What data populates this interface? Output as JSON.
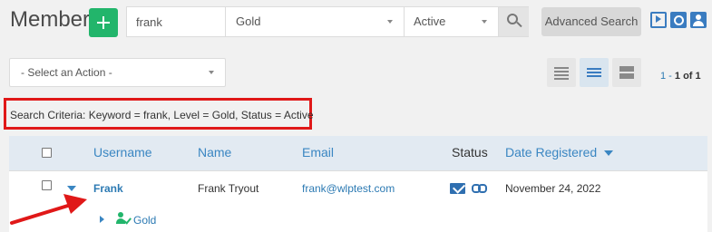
{
  "header": {
    "title": "Members",
    "add_icon": "plus-icon",
    "search": {
      "keyword_value": "frank",
      "level_value": "Gold",
      "status_value": "Active"
    },
    "search_icon": "search-icon",
    "advanced_search_label": "Advanced Search",
    "icons": [
      "video-icon",
      "document-search-icon",
      "user-icon"
    ]
  },
  "toolbar": {
    "action_select": "- Select an Action -",
    "view_icons": [
      "list-compact-icon",
      "list-icon",
      "grid-icon"
    ],
    "pagination": {
      "start": "1",
      "dash": " - ",
      "end": "1",
      "of_label": " of ",
      "total": "1"
    }
  },
  "criteria": {
    "text": "Search Criteria: Keyword = frank, Level = Gold, Status = Active"
  },
  "table": {
    "columns": [
      "Username",
      "Name",
      "Email",
      "Status",
      "Date Registered"
    ],
    "rows": [
      {
        "username": "Frank",
        "name": "Frank Tryout",
        "email": "frank@wlptest.com",
        "status_icons": [
          "mail-icon",
          "link-icon"
        ],
        "date": "November 24, 2022",
        "level": "Gold"
      }
    ]
  },
  "colors": {
    "accent": "#3a86c2",
    "add_button": "#22b56b",
    "highlight": "#e01818"
  }
}
